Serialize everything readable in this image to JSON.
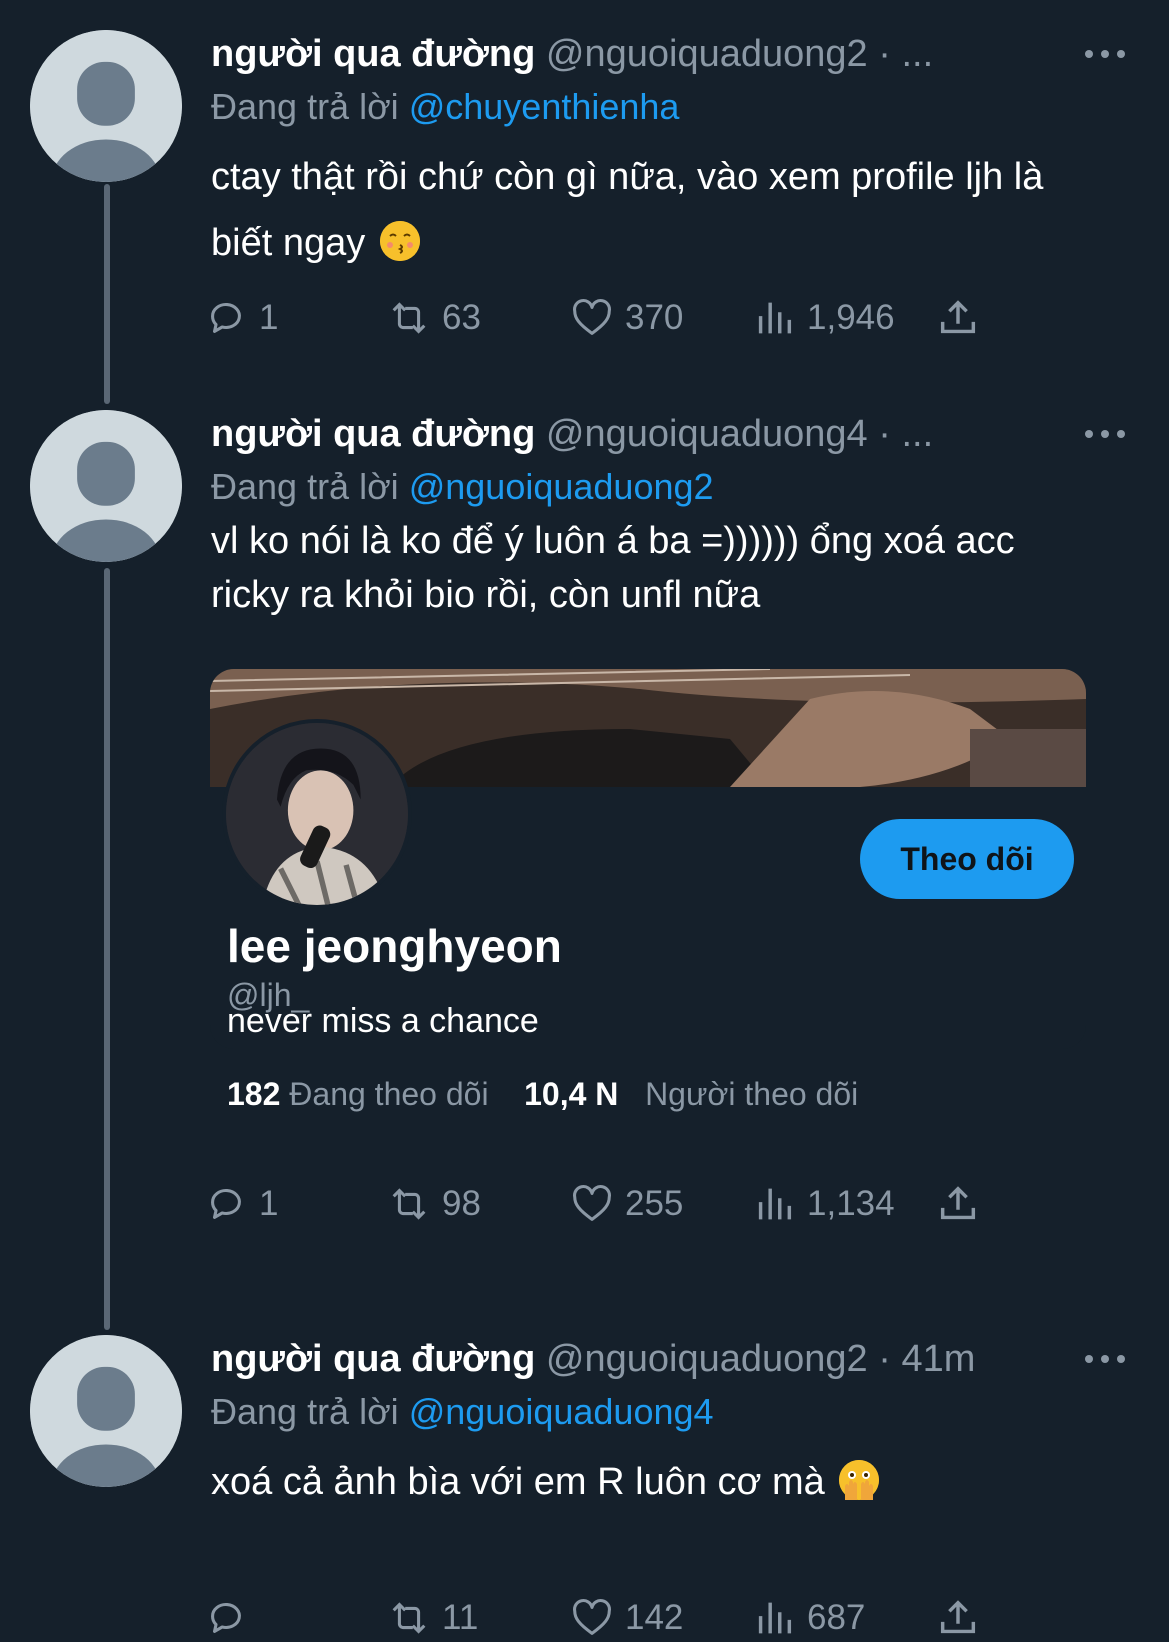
{
  "tweets": [
    {
      "name": "người qua đường",
      "handle": "@nguoiquaduong2 · ...",
      "reply_prefix": "Đang trả lời",
      "reply_to": "@chuyenthienha",
      "text": "ctay thật rồi chứ còn gì nữa, vào xem profile ljh là biết ngay",
      "emoji": "kissing-face-emoji",
      "replies": "1",
      "retweets": "63",
      "likes": "370",
      "views": "1,946"
    },
    {
      "name": "người qua đường",
      "handle": "@nguoiquaduong4 · ...",
      "reply_prefix": "Đang trả lời",
      "reply_to": "@nguoiquaduong2",
      "text": "vl ko nói là ko để ý luôn á ba =)))))) ổng xoá acc ricky ra khỏi bio rồi, còn unfl nữa",
      "replies": "1",
      "retweets": "98",
      "likes": "255",
      "views": "1,134",
      "card": {
        "name": "lee jeonghyeon",
        "handle": "@ljh_",
        "bio": "never miss a chance",
        "following_count": "182",
        "following_label": "Đang theo dõi",
        "followers_count": "10,4 N",
        "followers_label": "Người theo dõi",
        "follow_button": "Theo dõi"
      }
    },
    {
      "name": "người qua đường",
      "handle": "@nguoiquaduong2 · 41m",
      "reply_prefix": "Đang trả lời",
      "reply_to": "@nguoiquaduong4",
      "text": "xoá cả ảnh bìa với em R luôn cơ mà",
      "emoji": "face-with-open-eyes-and-hand-over-mouth-emoji",
      "replies": "",
      "retweets": "11",
      "likes": "142",
      "views": "687"
    }
  ],
  "colors": {
    "background": "#15202b",
    "accent": "#1d9bf0",
    "muted": "#8b98a5",
    "thread_line": "#5a6775"
  }
}
